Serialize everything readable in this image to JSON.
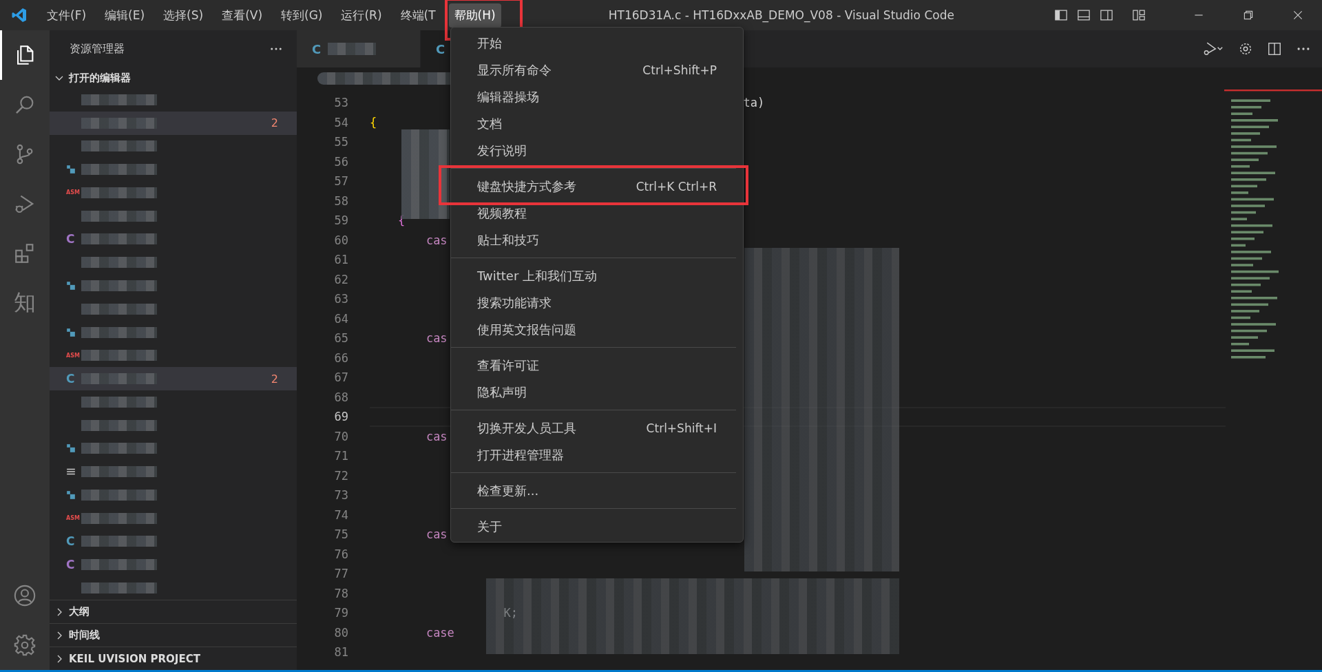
{
  "title_bar": {
    "menus": [
      {
        "label": "文件(F)",
        "selected": false,
        "annotated": false
      },
      {
        "label": "编辑(E)",
        "selected": false,
        "annotated": false
      },
      {
        "label": "选择(S)",
        "selected": false,
        "annotated": false
      },
      {
        "label": "查看(V)",
        "selected": false,
        "annotated": false
      },
      {
        "label": "转到(G)",
        "selected": false,
        "annotated": false
      },
      {
        "label": "运行(R)",
        "selected": false,
        "annotated": false
      },
      {
        "label": "终端(T",
        "selected": false,
        "annotated": false
      },
      {
        "label": "帮助(H)",
        "selected": true,
        "annotated": true
      }
    ],
    "title": "HT16D31A.c - HT16DxxAB_DEMO_V08 - Visual Studio Code"
  },
  "activity_bar": {
    "items": [
      {
        "kind": "explorer",
        "selected": true
      },
      {
        "kind": "search",
        "selected": false
      },
      {
        "kind": "source-control",
        "selected": false
      },
      {
        "kind": "run-debug",
        "selected": false
      },
      {
        "kind": "extensions",
        "selected": false
      },
      {
        "kind": "text",
        "label": "知",
        "selected": false
      }
    ],
    "bottom": [
      {
        "kind": "account"
      },
      {
        "kind": "settings"
      }
    ]
  },
  "sidebar": {
    "title": "资源管理器",
    "section": "打开的编辑器",
    "rows": [
      {
        "kind": "none",
        "selected": false
      },
      {
        "kind": "none",
        "badge": "2",
        "selected": true
      },
      {
        "kind": "none",
        "selected": false
      },
      {
        "kind": "file",
        "selected": false
      },
      {
        "kind": "asm",
        "icon": "ASM",
        "color": "#e34c4c",
        "selected": false
      },
      {
        "kind": "none",
        "selected": false
      },
      {
        "kind": "c",
        "icon": "C",
        "color": "#a074c4",
        "selected": false
      },
      {
        "kind": "none",
        "selected": false
      },
      {
        "kind": "file",
        "selected": false
      },
      {
        "kind": "none",
        "selected": false
      },
      {
        "kind": "file",
        "selected": false
      },
      {
        "kind": "asm",
        "icon": "ASM",
        "color": "#e34c4c",
        "selected": false
      },
      {
        "kind": "c",
        "icon": "C",
        "color": "#519aba",
        "badge": "2",
        "selected": true
      },
      {
        "kind": "none",
        "selected": false
      },
      {
        "kind": "none",
        "selected": false
      },
      {
        "kind": "file",
        "selected": false
      },
      {
        "kind": "list",
        "selected": false
      },
      {
        "kind": "file",
        "selected": false
      },
      {
        "kind": "asm",
        "icon": "ASM",
        "color": "#e34c4c",
        "selected": false
      },
      {
        "kind": "c",
        "icon": "C",
        "color": "#519aba",
        "selected": false
      },
      {
        "kind": "c",
        "icon": "C",
        "color": "#a074c4",
        "selected": false
      },
      {
        "kind": "none",
        "selected": false
      }
    ],
    "sections": [
      "大纲",
      "时间线",
      "KEIL UVISION PROJECT"
    ]
  },
  "editor": {
    "tabs": [
      {
        "icon": "C",
        "selected": false
      },
      {
        "icon": "C",
        "selected": true
      }
    ],
    "lines": [
      {
        "number": "53",
        "code": [
          {
            "kind": "text",
            "text": "                                                     ta)"
          }
        ],
        "current": false
      },
      {
        "number": "54",
        "code": [
          {
            "kind": "bracket-1",
            "text": "{"
          }
        ],
        "current": false
      },
      {
        "number": "55",
        "current": false
      },
      {
        "number": "56",
        "current": false
      },
      {
        "number": "57",
        "current": false
      },
      {
        "number": "58",
        "current": false
      },
      {
        "number": "59",
        "code": [
          {
            "kind": "bracket-2",
            "text": "    {"
          }
        ],
        "current": false
      },
      {
        "number": "60",
        "code": [
          {
            "kind": "keyword",
            "text": "        cas"
          }
        ],
        "current": false
      },
      {
        "number": "61",
        "current": false
      },
      {
        "number": "62",
        "current": false
      },
      {
        "number": "63",
        "current": false
      },
      {
        "number": "64",
        "current": false
      },
      {
        "number": "65",
        "code": [
          {
            "kind": "keyword",
            "text": "        cas"
          }
        ],
        "current": false
      },
      {
        "number": "66",
        "current": false
      },
      {
        "number": "67",
        "current": false
      },
      {
        "number": "68",
        "current": false
      },
      {
        "number": "69",
        "current": true
      },
      {
        "number": "70",
        "code": [
          {
            "kind": "keyword",
            "text": "        cas"
          }
        ],
        "current": false
      },
      {
        "number": "71",
        "current": false
      },
      {
        "number": "72",
        "current": false
      },
      {
        "number": "73",
        "current": false
      },
      {
        "number": "74",
        "current": false
      },
      {
        "number": "75",
        "code": [
          {
            "kind": "keyword",
            "text": "        cas"
          }
        ],
        "current": false
      },
      {
        "number": "76",
        "current": false
      },
      {
        "number": "77",
        "current": false
      },
      {
        "number": "78",
        "current": false
      },
      {
        "number": "79",
        "code": [
          {
            "kind": "text",
            "text": "                   K;"
          }
        ],
        "current": false
      },
      {
        "number": "80",
        "code": [
          {
            "kind": "keyword",
            "text": "        case"
          }
        ],
        "current": false
      },
      {
        "number": "81",
        "current": false
      }
    ]
  },
  "help_menu": {
    "groups": [
      [
        {
          "label": "开始",
          "annotated": false
        },
        {
          "label": "显示所有命令",
          "shortcut": "Ctrl+Shift+P",
          "annotated": false
        },
        {
          "label": "编辑器操场",
          "annotated": false
        },
        {
          "label": "文档",
          "annotated": false
        },
        {
          "label": "发行说明",
          "annotated": false
        }
      ],
      [
        {
          "label": "键盘快捷方式参考",
          "shortcut": "Ctrl+K Ctrl+R",
          "annotated": true
        },
        {
          "label": "视频教程",
          "annotated": false
        },
        {
          "label": "贴士和技巧",
          "annotated": false
        }
      ],
      [
        {
          "label": "Twitter 上和我们互动",
          "annotated": false
        },
        {
          "label": "搜索功能请求",
          "annotated": false
        },
        {
          "label": "使用英文报告问题",
          "annotated": false
        }
      ],
      [
        {
          "label": "查看许可证",
          "annotated": false
        },
        {
          "label": "隐私声明",
          "annotated": false
        }
      ],
      [
        {
          "label": "切换开发人员工具",
          "shortcut": "Ctrl+Shift+I",
          "annotated": false
        },
        {
          "label": "打开进程管理器",
          "annotated": false
        }
      ],
      [
        {
          "label": "检查更新...",
          "annotated": false
        }
      ],
      [
        {
          "label": "关于",
          "annotated": false
        }
      ]
    ]
  }
}
